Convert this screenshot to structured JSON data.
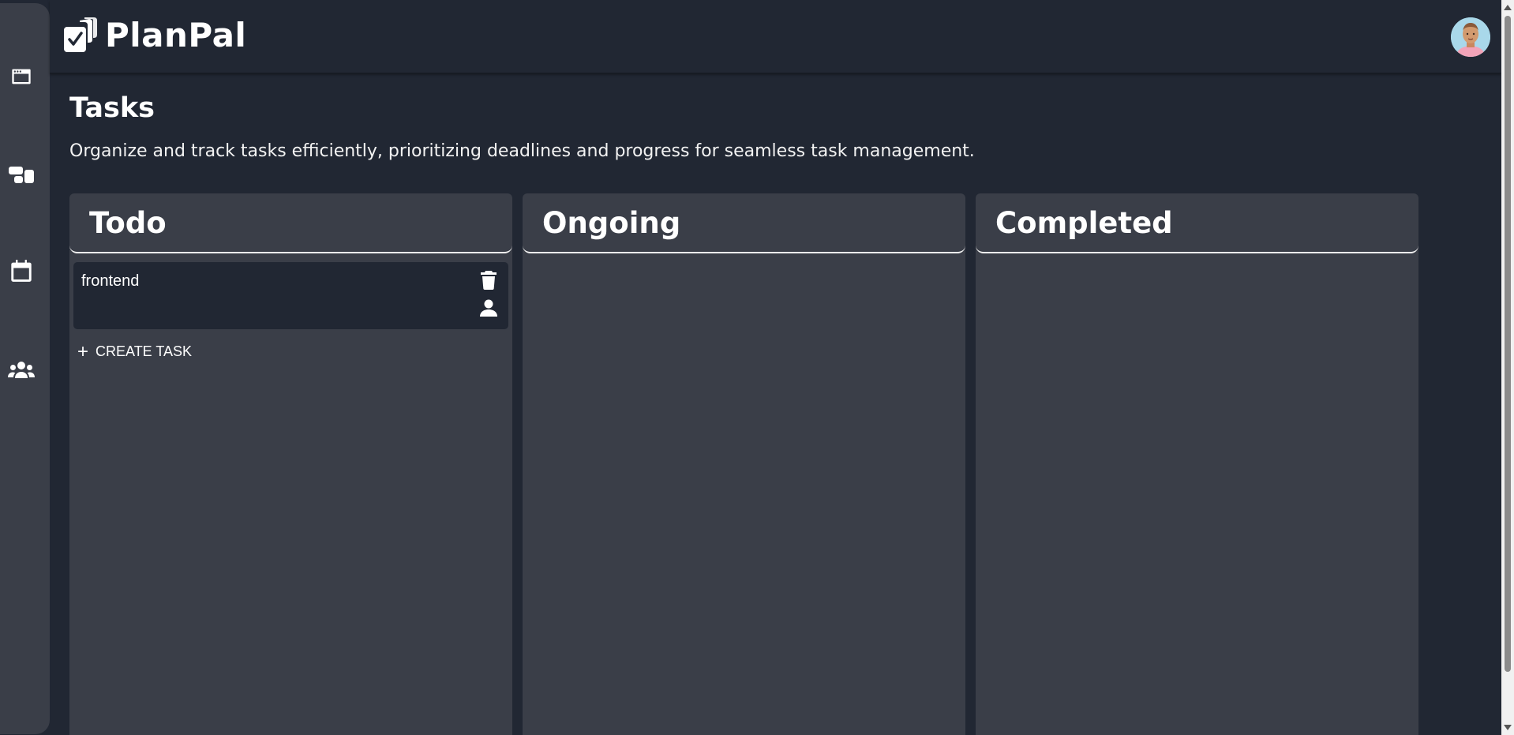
{
  "app": {
    "name": "PlanPal"
  },
  "sidebar": {
    "items": [
      {
        "name": "dashboard",
        "icon": "browser-window-icon"
      },
      {
        "name": "boards",
        "icon": "board-layout-icon"
      },
      {
        "name": "calendar",
        "icon": "calendar-icon"
      },
      {
        "name": "team",
        "icon": "team-icon"
      }
    ]
  },
  "header": {
    "avatar_icon": "user-avatar"
  },
  "main": {
    "title": "Tasks",
    "description": "Organize and track tasks efficiently, prioritizing deadlines and progress for seamless task management."
  },
  "columns": [
    {
      "title": "Todo",
      "tasks": [
        {
          "title": "frontend",
          "actions": [
            "trash-icon",
            "person-icon"
          ]
        }
      ],
      "create_label": "CREATE TASK"
    },
    {
      "title": "Ongoing",
      "tasks": []
    },
    {
      "title": "Completed",
      "tasks": []
    }
  ],
  "colors": {
    "background": "#212733",
    "panel": "#3a3e48",
    "card": "#212733",
    "text": "#ffffff"
  }
}
